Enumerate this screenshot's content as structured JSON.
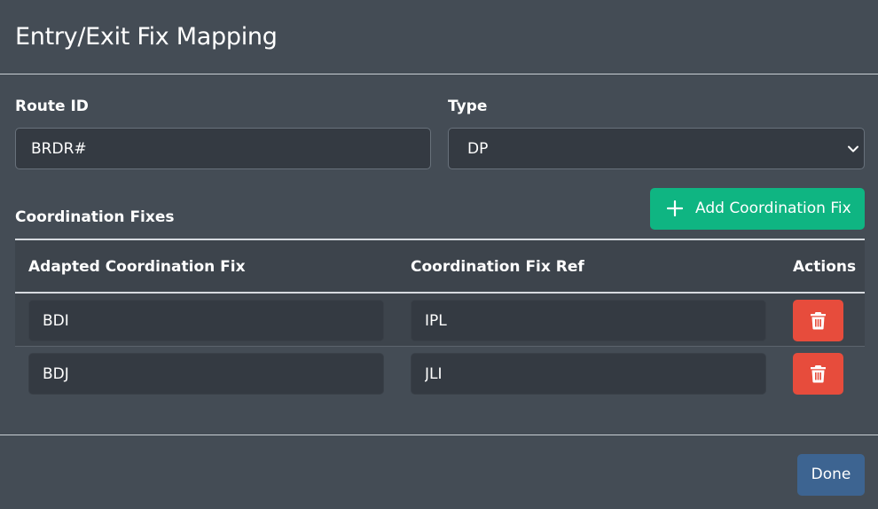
{
  "modal": {
    "title": "Entry/Exit Fix Mapping"
  },
  "form": {
    "route_id_label": "Route ID",
    "route_id_value": "BRDR#",
    "type_label": "Type",
    "type_value": "DP"
  },
  "coordination": {
    "section_label": "Coordination Fixes",
    "add_button_label": "Add Coordination Fix",
    "columns": [
      "Adapted Coordination Fix",
      "Coordination Fix Ref",
      "Actions"
    ],
    "rows": [
      {
        "adapted": "BDI",
        "ref": "IPL"
      },
      {
        "adapted": "BDJ",
        "ref": "JLI"
      }
    ]
  },
  "footer": {
    "done_label": "Done"
  },
  "icons": {
    "add": "plus-icon",
    "delete": "trash-icon",
    "select": "chevron-down-icon"
  },
  "colors": {
    "background": "#444c55",
    "input_bg": "#343a42",
    "add_button": "#0fb582",
    "delete_button": "#e74c3c",
    "done_button": "#3d6491"
  }
}
